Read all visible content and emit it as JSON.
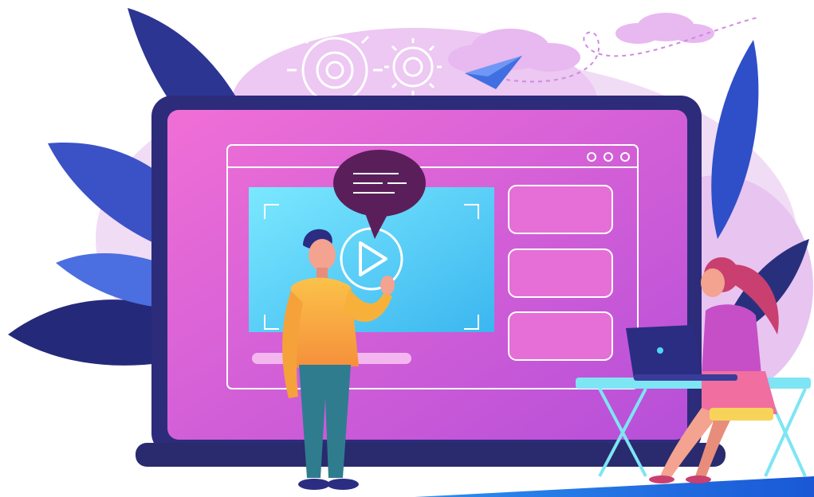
{
  "scene": {
    "description_icons": [
      "gear-icon",
      "paper-plane-icon",
      "cloud-icon",
      "speech-bubble-icon",
      "play-icon",
      "window-dots-icon",
      "laptop-icon"
    ],
    "colors": {
      "background": "#ffffff",
      "blob_lilac": "#e9c7f0",
      "leaf_dark": "#262a7a",
      "leaf_blue": "#3b5fd0",
      "screen_pink": "#d94fd0",
      "screen_bezel": "#2d2c7a",
      "video_cyan": "#4fd6f2",
      "speech_bubble": "#5a1f5a",
      "man_shirt": "#f7b13a",
      "man_pants": "#2f7c8f",
      "woman_top": "#c64fc8",
      "desk_blue": "#7ee5f4",
      "floor_blue": "#1d6fe0"
    }
  }
}
